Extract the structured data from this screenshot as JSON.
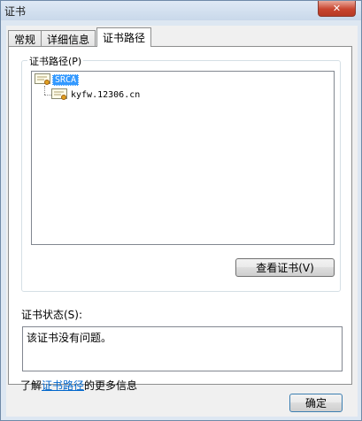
{
  "window": {
    "title": "证书",
    "close_icon": "close-icon"
  },
  "tabs": [
    {
      "label": "常规"
    },
    {
      "label": "详细信息"
    },
    {
      "label": "证书路径"
    }
  ],
  "path_group": {
    "legend": "证书路径(P)",
    "nodes": [
      {
        "label": "SRCA",
        "selected": true
      },
      {
        "label": "kyfw.12306.cn",
        "selected": false
      }
    ],
    "view_button": "查看证书(V)"
  },
  "status": {
    "label": "证书状态(S):",
    "text": "该证书没有问题。"
  },
  "learn_more": {
    "prefix": "了解",
    "link": "证书路径",
    "suffix": "的更多信息"
  },
  "ok_button": "确定"
}
